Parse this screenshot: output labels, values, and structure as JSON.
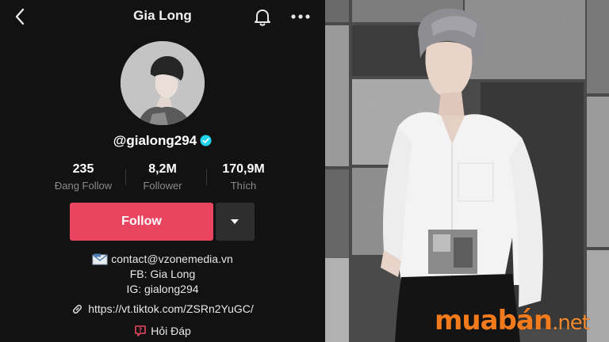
{
  "header": {
    "title": "Gia Long",
    "back_icon": "chevron-left-icon",
    "bell_icon": "bell-icon",
    "more_icon": "more-horizontal-icon"
  },
  "profile": {
    "handle": "@gialong294",
    "verified": true,
    "stats": [
      {
        "value": "235",
        "label": "Đang Follow"
      },
      {
        "value": "8,2M",
        "label": "Follower"
      },
      {
        "value": "170,9M",
        "label": "Thích"
      }
    ],
    "follow_label": "Follow",
    "bio": {
      "contact": "contact@vzonemedia.vn",
      "fb": "FB: Gia Long",
      "ig": "IG: gialong294"
    },
    "link": "https://vt.tiktok.com/ZSRn2YuGC/",
    "qa_label": "Hỏi Đáp"
  },
  "watermark": {
    "brand": "muabán",
    "tld": ".net"
  },
  "colors": {
    "follow_accent": "#ea4560",
    "verified_blue": "#20d5ec",
    "watermark_orange": "#f07a1c",
    "panel_bg": "#121212"
  }
}
